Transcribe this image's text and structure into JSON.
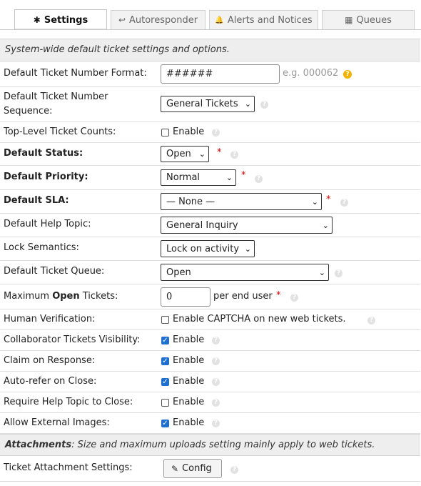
{
  "tabs": [
    {
      "label": "Settings",
      "icon": "✱"
    },
    {
      "label": "Autoresponder",
      "icon": "↩"
    },
    {
      "label": "Alerts and Notices",
      "icon": "🔔"
    },
    {
      "label": "Queues",
      "icon": "▦"
    }
  ],
  "section_header": "System-wide default ticket settings and options.",
  "rows": {
    "ticket_number_format": {
      "label": "Default Ticket Number Format:",
      "value": "######",
      "hint": "e.g. 000062"
    },
    "ticket_number_sequence": {
      "label": "Default Ticket Number Sequence:",
      "value": "General Tickets"
    },
    "top_level_counts": {
      "label": "Top-Level Ticket Counts:",
      "checkbox_label": "Enable"
    },
    "default_status": {
      "label": "Default Status:",
      "value": "Open"
    },
    "default_priority": {
      "label": "Default Priority:",
      "value": "Normal"
    },
    "default_sla": {
      "label": "Default SLA:",
      "value": "— None —"
    },
    "default_help_topic": {
      "label": "Default Help Topic:",
      "value": "General Inquiry"
    },
    "lock_semantics": {
      "label": "Lock Semantics:",
      "value": "Lock on activity"
    },
    "default_queue": {
      "label": "Default Ticket Queue:",
      "value": "Open"
    },
    "max_open": {
      "label_pre": "Maximum ",
      "label_bold": "Open",
      "label_post": " Tickets:",
      "value": "0",
      "suffix": "per end user"
    },
    "human_verification": {
      "label": "Human Verification:",
      "checkbox_label": "Enable CAPTCHA on new web tickets."
    },
    "collab_visibility": {
      "label": "Collaborator Tickets Visibility:",
      "checkbox_label": "Enable"
    },
    "claim_on_response": {
      "label": "Claim on Response:",
      "checkbox_label": "Enable"
    },
    "auto_refer": {
      "label": "Auto-refer on Close:",
      "checkbox_label": "Enable"
    },
    "require_help_topic": {
      "label": "Require Help Topic to Close:",
      "checkbox_label": "Enable"
    },
    "allow_external_images": {
      "label": "Allow External Images:",
      "checkbox_label": "Enable"
    }
  },
  "attachments_header": {
    "bold": "Attachments",
    "text": ": Size and maximum uploads setting mainly apply to web tickets."
  },
  "attachment_settings": {
    "label": "Ticket Attachment Settings:",
    "button_label": "Config"
  },
  "required_mark": "*",
  "help_glyph": "?",
  "colors": {
    "required": "#d40000",
    "checkbox_checked": "#1f6fd1",
    "hint_warning": "#f0b400",
    "section_bg": "#eeeeee"
  }
}
